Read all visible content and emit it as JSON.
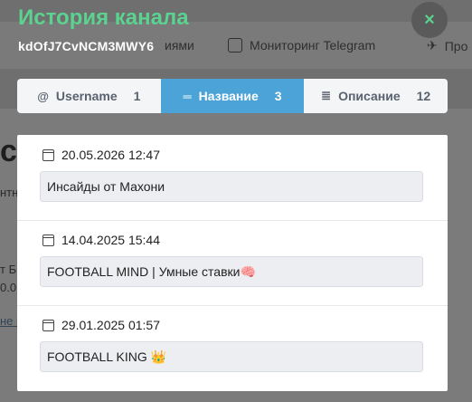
{
  "background": {
    "nav": [
      {
        "label": "иями",
        "icon": "list-icon"
      },
      {
        "label": "Мониторинг Telegram",
        "icon": "monitor-icon"
      },
      {
        "label": "Про",
        "icon": "rocket-icon"
      }
    ],
    "fragments": {
      "big": "са",
      "small1": "нтн",
      "small2": "т Б",
      "small3": "0.0",
      "link": "не н"
    }
  },
  "modal": {
    "title": "История канала",
    "subtitle": "kdOfJ7CvNCM3MWY6",
    "close_icon": "×",
    "tabs": [
      {
        "icon": "@",
        "label": "Username",
        "count": "1",
        "active": false
      },
      {
        "icon": "═",
        "label": "Название",
        "count": "3",
        "active": true
      },
      {
        "icon": "≣",
        "label": "Описание",
        "count": "12",
        "active": false
      }
    ],
    "entries": [
      {
        "date": "20.05.2026 12:47",
        "value": "Инсайды от Махони"
      },
      {
        "date": "14.04.2025 15:44",
        "value": "FOOTBALL MIND | Умные ставки🧠"
      },
      {
        "date": "29.01.2025 01:57",
        "value": "FOOTBALL KING 👑"
      }
    ]
  },
  "colors": {
    "accent": "#5bd28f",
    "tab_active": "#4ba3d8"
  }
}
